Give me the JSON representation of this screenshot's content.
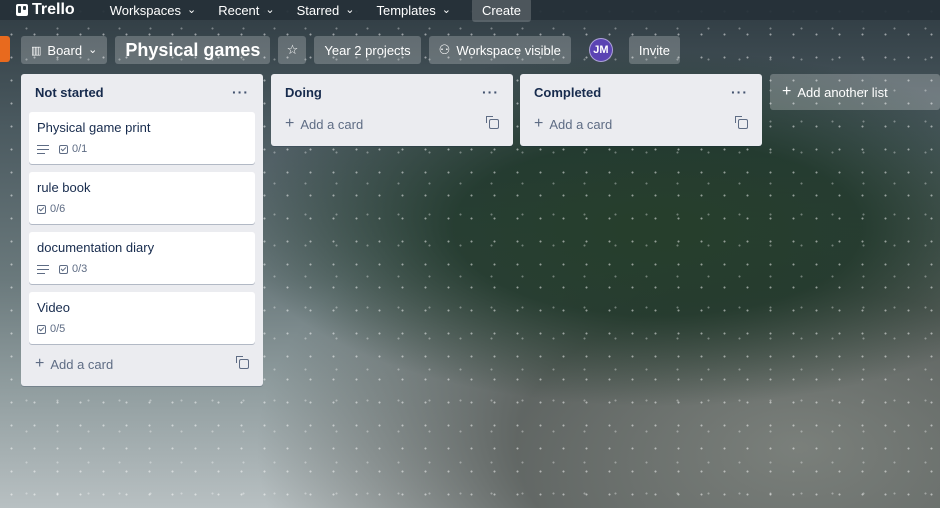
{
  "nav": {
    "brand": "Trello",
    "items": [
      "Workspaces",
      "Recent",
      "Starred",
      "Templates"
    ],
    "create": "Create"
  },
  "board": {
    "view": "Board",
    "title": "Physical games",
    "workspace": "Year 2 projects",
    "visibility": "Workspace visible",
    "member_initials": "JM",
    "invite": "Invite"
  },
  "lists": [
    {
      "title": "Not started",
      "cards": [
        {
          "title": "Physical game print",
          "has_description": true,
          "checklist": "0/1"
        },
        {
          "title": "rule book",
          "has_description": false,
          "checklist": "0/6"
        },
        {
          "title": "documentation diary",
          "has_description": true,
          "checklist": "0/3"
        },
        {
          "title": "Video",
          "has_description": false,
          "checklist": "0/5"
        }
      ],
      "add_card": "Add a card"
    },
    {
      "title": "Doing",
      "cards": [],
      "add_card": "Add a card"
    },
    {
      "title": "Completed",
      "cards": [],
      "add_card": "Add a card"
    }
  ],
  "add_list": "Add another list",
  "colors": {
    "nav_bg": "#263039",
    "list_bg": "#ebecf0",
    "accent": "#e86a1e",
    "avatar": "#5b44b3"
  }
}
